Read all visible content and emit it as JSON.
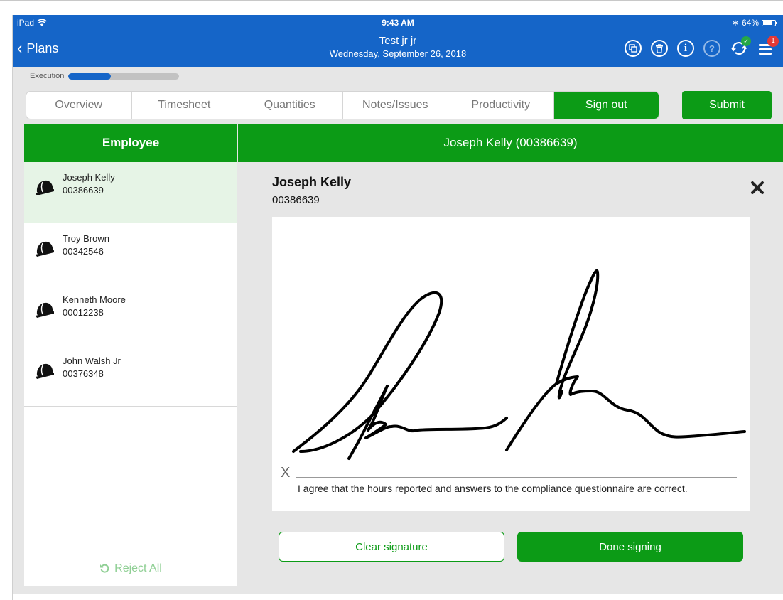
{
  "status_bar": {
    "device": "iPad",
    "time": "9:43 AM",
    "battery": "64%"
  },
  "header": {
    "back_label": "Plans",
    "title": "Test jr jr",
    "subtitle": "Wednesday, September 26, 2018",
    "notification_count": "1",
    "icons": [
      "copy-icon",
      "trash-icon",
      "info-icon",
      "help-icon",
      "sync-icon",
      "menu-icon"
    ]
  },
  "progress": {
    "label": "Execution",
    "value_fraction": 0.38
  },
  "tabs": [
    {
      "label": "Overview",
      "active": false
    },
    {
      "label": "Timesheet",
      "active": false
    },
    {
      "label": "Quantities",
      "active": false
    },
    {
      "label": "Notes/Issues",
      "active": false
    },
    {
      "label": "Productivity",
      "active": false
    },
    {
      "label": "Sign out",
      "active": true
    }
  ],
  "submit_label": "Submit",
  "employee_panel": {
    "header": "Employee",
    "employees": [
      {
        "name": "Joseph Kelly",
        "id": "00386639",
        "selected": true
      },
      {
        "name": "Troy Brown",
        "id": "00342546",
        "selected": false
      },
      {
        "name": "Kenneth Moore",
        "id": "00012238",
        "selected": false
      },
      {
        "name": "John Walsh Jr",
        "id": "00376348",
        "selected": false
      }
    ],
    "reject_all_label": "Reject All"
  },
  "detail": {
    "header": "Joseph Kelly (00386639)",
    "name": "Joseph Kelly",
    "id": "00386639",
    "signature_marker": "X",
    "agreement_text": "I agree that the hours reported and answers to the compliance questionnaire are correct.",
    "clear_label": "Clear signature",
    "done_label": "Done signing"
  },
  "colors": {
    "header_blue": "#1565c8",
    "accent_green": "#0c9b16",
    "selected_row": "#e6f4e6",
    "badge_red": "#e53935"
  }
}
